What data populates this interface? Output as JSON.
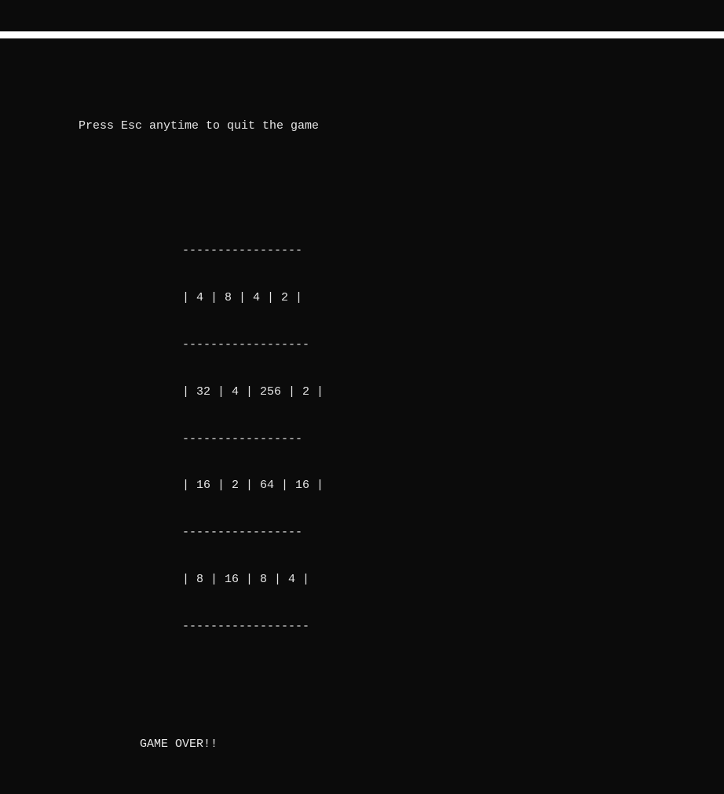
{
  "hint": "Press Esc anytime to quit the game",
  "board": {
    "dash_top": "-----------------",
    "row0": "| 4 | 8 | 4 | 2 |",
    "dash1": "------------------",
    "row1": "| 32 | 4 | 256 | 2 |",
    "dash2": "-----------------",
    "row2": "| 16 | 2 | 64 | 16 |",
    "dash3": "-----------------",
    "row3": "| 8 | 16 | 8 | 4 |",
    "dash_bottom": "------------------",
    "cells": [
      [
        4,
        8,
        4,
        2
      ],
      [
        32,
        4,
        256,
        2
      ],
      [
        16,
        2,
        64,
        16
      ],
      [
        8,
        16,
        8,
        4
      ]
    ]
  },
  "status": "GAME OVER!!"
}
